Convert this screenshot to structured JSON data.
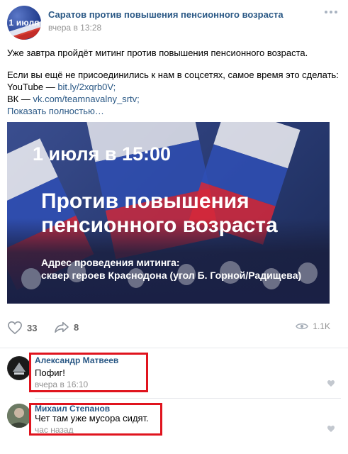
{
  "post": {
    "group_name": "Саратов против повышения пенсионного возраста",
    "avatar_text": "1 июля",
    "time": "вчера в 13:28",
    "text_line1": "Уже завтра пройдёт митинг против повышения пенсионного возраста.",
    "text_line2": "Если вы ещё не присоединились к нам в соцсетях, самое время это сделать:",
    "youtube_label": "YouTube — ",
    "youtube_link": "bit.ly/2xqrb0V;",
    "vk_label": "ВК — ",
    "vk_link": "vk.com/teamnavalny_srtv;",
    "show_more": "Показать полностью…"
  },
  "banner": {
    "date": "1 июля в 15:00",
    "title_line1": "Против повышения",
    "title_line2": "пенсионного возраста",
    "address_line1": "Адрес проведения митинга:",
    "address_line2": "сквер героев Краснодона (угол Б. Горной/Радищева)"
  },
  "actions": {
    "likes": "33",
    "shares": "8",
    "views": "1.1K"
  },
  "comments": [
    {
      "author": "Александр Матвеев",
      "text": "Пофиг!",
      "time": "вчера в 16:10"
    },
    {
      "author": "Михаил Степанов",
      "text": "Чет там уже мусора сидят.",
      "time": "час назад"
    }
  ],
  "colors": {
    "link": "#2a5885",
    "highlight_box": "#e0141e"
  }
}
